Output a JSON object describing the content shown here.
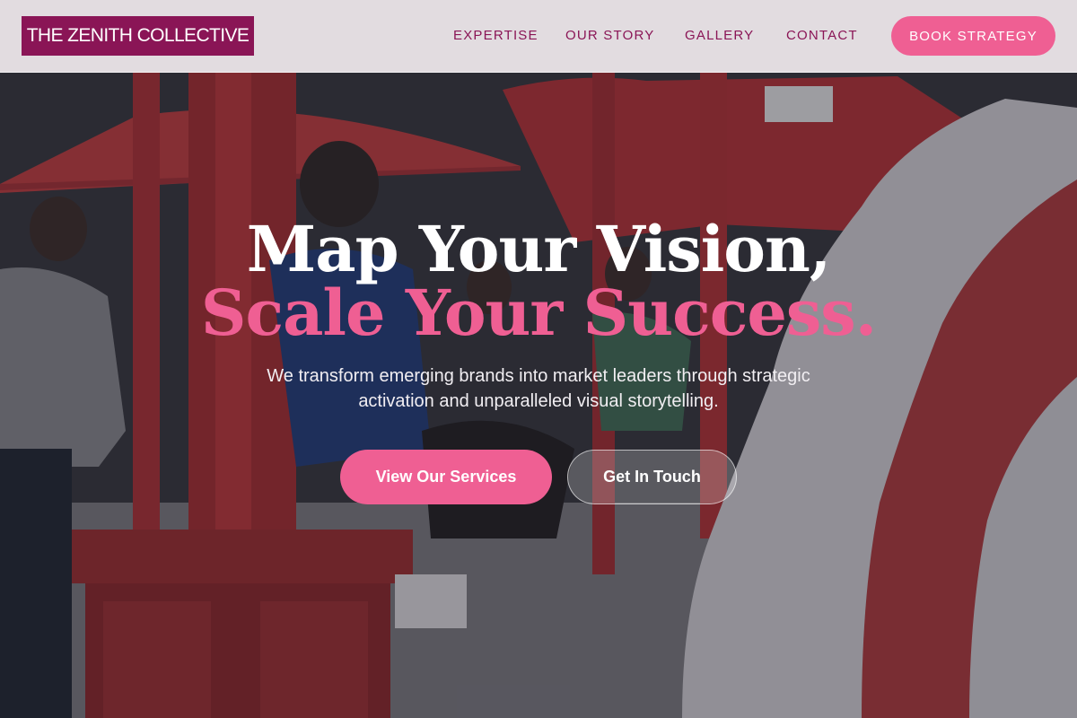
{
  "brand": {
    "logo_text": "THE ZENITH COLLECTIVE"
  },
  "nav": {
    "items": [
      {
        "label": "EXPERTISE"
      },
      {
        "label": "OUR STORY"
      },
      {
        "label": "GALLERY"
      },
      {
        "label": "CONTACT"
      }
    ],
    "cta_label": "BOOK STRATEGY"
  },
  "hero": {
    "headline_line1": "Map Your Vision,",
    "headline_line2": "Scale Your Success.",
    "subtext": "We transform emerging brands into market leaders through strategic activation and unparalleled visual storytelling.",
    "primary_button": "View Our Services",
    "secondary_button": "Get In Touch",
    "background_image": "event-activation-photo"
  },
  "colors": {
    "brand_primary": "#8a1556",
    "accent_pink": "#ef5f93",
    "header_bg": "#eee8ec"
  }
}
